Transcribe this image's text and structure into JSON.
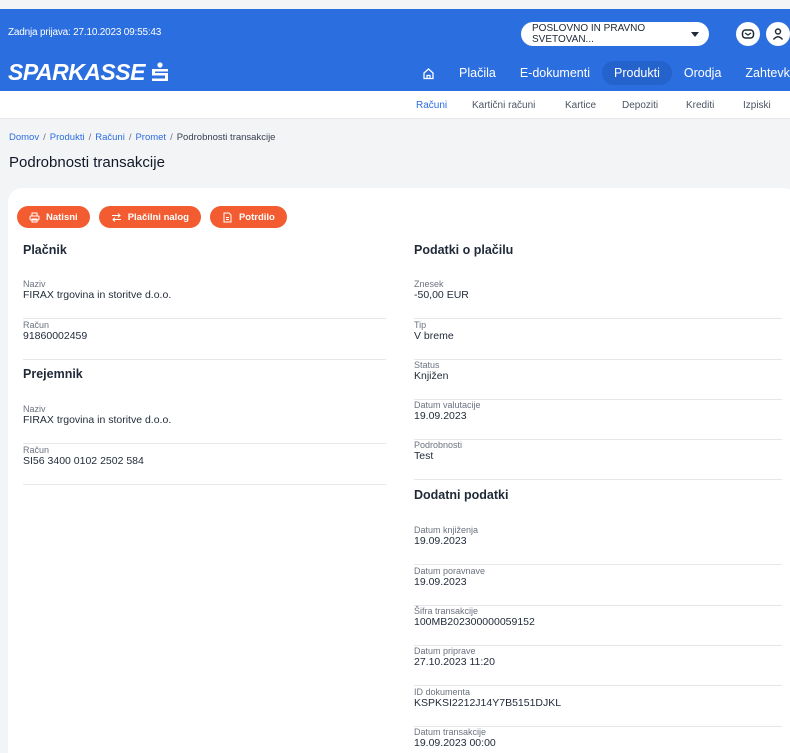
{
  "header": {
    "last_login": "Zadnja prijava: 27.10.2023 09:55:43",
    "company_select": "POSLOVNO IN PRAVNO SVETOVAN...",
    "logo_text": "SPARKASSE",
    "brand_color": "#2b6ee0",
    "nav": [
      {
        "label": "Plačila"
      },
      {
        "label": "E-dokumenti"
      },
      {
        "label": "Produkti"
      },
      {
        "label": "Orodja"
      },
      {
        "label": "Zahtevki"
      }
    ]
  },
  "subnav": [
    "Računi",
    "Kartični računi",
    "Kartice",
    "Depoziti",
    "Krediti",
    "Izpiski"
  ],
  "breadcrumb": [
    "Domov",
    "Produkti",
    "Računi",
    "Promet",
    "Podrobnosti transakcije"
  ],
  "page_title": "Podrobnosti transakcije",
  "actions": {
    "print": "Natisni",
    "payment_order": "Plačilni nalog",
    "receipt": "Potrdilo",
    "accent_color": "#f25c30"
  },
  "payer": {
    "title": "Plačnik",
    "fields": [
      {
        "label": "Naziv",
        "value": "FIRAX trgovina in storitve d.o.o."
      },
      {
        "label": "Račun",
        "value": "91860002459"
      }
    ]
  },
  "recipient": {
    "title": "Prejemnik",
    "fields": [
      {
        "label": "Naziv",
        "value": "FIRAX trgovina in storitve d.o.o."
      },
      {
        "label": "Račun",
        "value": "SI56 3400 0102 2502 584"
      }
    ]
  },
  "payment": {
    "title": "Podatki o plačilu",
    "fields": [
      {
        "label": "Znesek",
        "value": "-50,00 EUR"
      },
      {
        "label": "Tip",
        "value": "V breme"
      },
      {
        "label": "Status",
        "value": "Knjižen"
      },
      {
        "label": "Datum valutacije",
        "value": "19.09.2023"
      },
      {
        "label": "Podrobnosti",
        "value": "Test"
      }
    ]
  },
  "additional": {
    "title": "Dodatni podatki",
    "fields": [
      {
        "label": "Datum knjiženja",
        "value": "19.09.2023"
      },
      {
        "label": "Datum poravnave",
        "value": "19.09.2023"
      },
      {
        "label": "Šifra transakcije",
        "value": "100MB202300000059152"
      },
      {
        "label": "Datum priprave",
        "value": "27.10.2023 11:20"
      },
      {
        "label": "ID dokumenta",
        "value": "KSPKSI2212J14Y7B5151DJKL"
      },
      {
        "label": "Datum transakcije",
        "value": "19.09.2023 00:00"
      }
    ]
  }
}
